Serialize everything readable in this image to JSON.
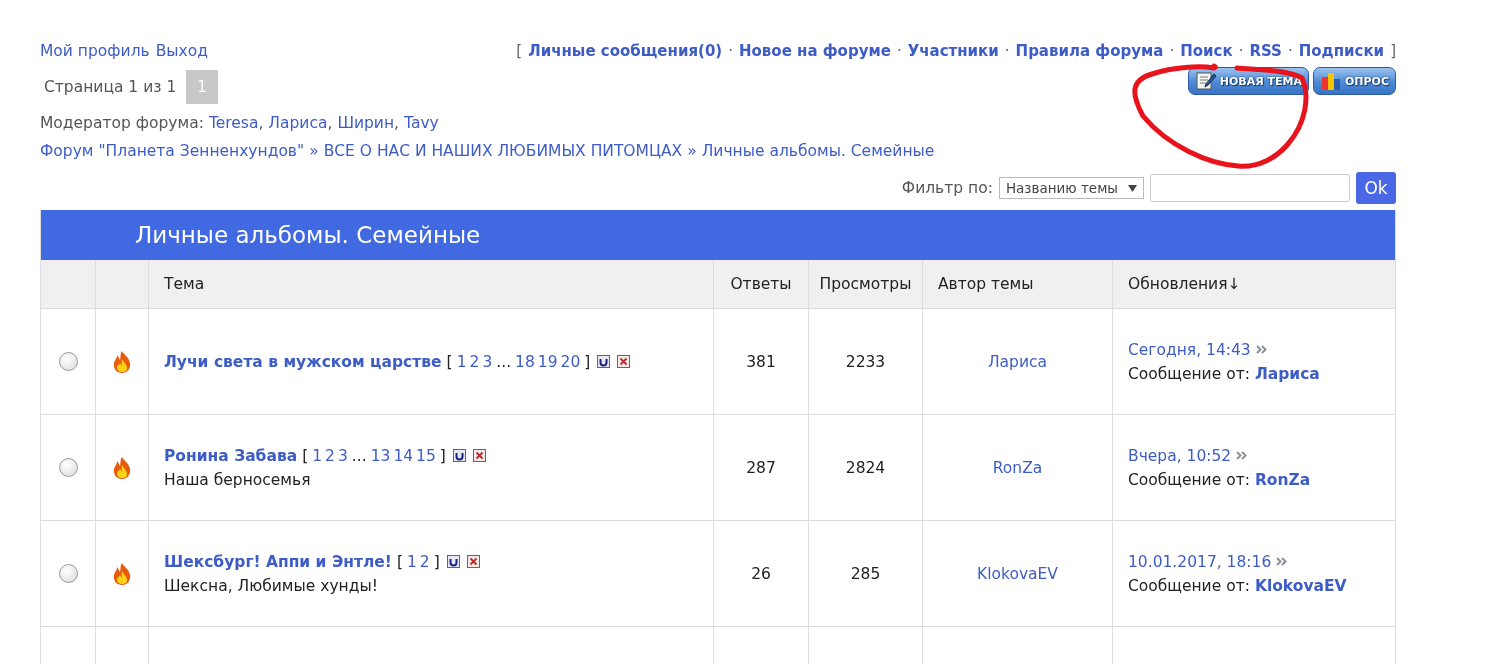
{
  "user_links": [
    {
      "label": "Мой профиль"
    },
    {
      "label": "Выход"
    }
  ],
  "nav": {
    "open": "[",
    "close": "]",
    "links": [
      {
        "label": "Личные сообщения(0)"
      },
      {
        "label": "Новое на форуме",
        "sep": "·"
      },
      {
        "label": "Участники",
        "sep": "·"
      },
      {
        "label": "Правила форума",
        "sep": "·"
      },
      {
        "label": "Поиск",
        "sep": "·"
      },
      {
        "label": "RSS",
        "sep": "·"
      },
      {
        "label": "Подписки",
        "sep": "·"
      }
    ]
  },
  "action_buttons": [
    {
      "label": "НОВАЯ ТЕМА",
      "kind": "new-topic"
    },
    {
      "label": "ОПРОС",
      "kind": "poll"
    }
  ],
  "pagination": {
    "label": "Страница 1 из 1",
    "pages": [
      {
        "label": "1",
        "selected": true
      }
    ]
  },
  "moderators": {
    "label": "Модератор форума:",
    "names": [
      {
        "name": "Teresa"
      },
      {
        "name": "Лариса",
        "sep": ","
      },
      {
        "name": "Ширин",
        "sep": ","
      },
      {
        "name": "Tavy",
        "sep": ","
      }
    ]
  },
  "breadcrumbs": [
    {
      "label": "Форум \"Планета Зенненхундов\""
    },
    {
      "label": "ВСЕ О НАС И НАШИХ ЛЮБИМЫХ ПИТОМЦАХ",
      "sep": "»"
    },
    {
      "label": "Личные альбомы. Семейные",
      "sep": "»"
    }
  ],
  "filter": {
    "label": "Фильтр по:",
    "select": "Названию темы",
    "button": "Ok"
  },
  "forum_title": "Личные альбомы. Семейные",
  "columns": [
    "Тема",
    "Ответы",
    "Просмотры",
    "Автор темы",
    "Обновления↓"
  ],
  "rows": [
    {
      "selected": false,
      "title": "Лучи света в мужском царстве",
      "pages": [
        {
          "kind": "bracket",
          "label": "["
        },
        {
          "kind": "link",
          "label": "1"
        },
        {
          "kind": "link",
          "label": "2"
        },
        {
          "kind": "link",
          "label": "3"
        },
        {
          "kind": "gap",
          "label": "..."
        },
        {
          "kind": "link",
          "label": "18"
        },
        {
          "kind": "link",
          "label": "19"
        },
        {
          "kind": "link",
          "label": "20"
        },
        {
          "kind": "bracket",
          "label": "]"
        }
      ],
      "replies": "381",
      "views": "2233",
      "author": "Лариса",
      "last_time": "Сегодня, 14:43",
      "last_by_label": "Сообщение от:",
      "last_by": "Лариса"
    },
    {
      "selected": false,
      "title": "Ронина Забава",
      "pages": [
        {
          "kind": "bracket",
          "label": "["
        },
        {
          "kind": "link",
          "label": "1"
        },
        {
          "kind": "link",
          "label": "2"
        },
        {
          "kind": "link",
          "label": "3"
        },
        {
          "kind": "gap",
          "label": "..."
        },
        {
          "kind": "link",
          "label": "13"
        },
        {
          "kind": "link",
          "label": "14"
        },
        {
          "kind": "link",
          "label": "15"
        },
        {
          "kind": "bracket",
          "label": "]"
        }
      ],
      "description": "Наша берносемья",
      "replies": "287",
      "views": "2824",
      "author": "RonZa",
      "last_time": "Вчера, 10:52",
      "last_by_label": "Сообщение от:",
      "last_by": "RonZa"
    },
    {
      "selected": false,
      "title": "Шексбург! Аппи и Энтле!",
      "pages": [
        {
          "kind": "bracket",
          "label": "["
        },
        {
          "kind": "link",
          "label": "1"
        },
        {
          "kind": "link",
          "label": "2"
        },
        {
          "kind": "bracket",
          "label": "]"
        }
      ],
      "description": "Шексна, Любимые хунды!",
      "replies": "26",
      "views": "285",
      "author": "KlokovaEV",
      "last_time": "10.01.2017, 18:16",
      "last_by_label": "Сообщение от:",
      "last_by": "KlokovaEV"
    }
  ]
}
